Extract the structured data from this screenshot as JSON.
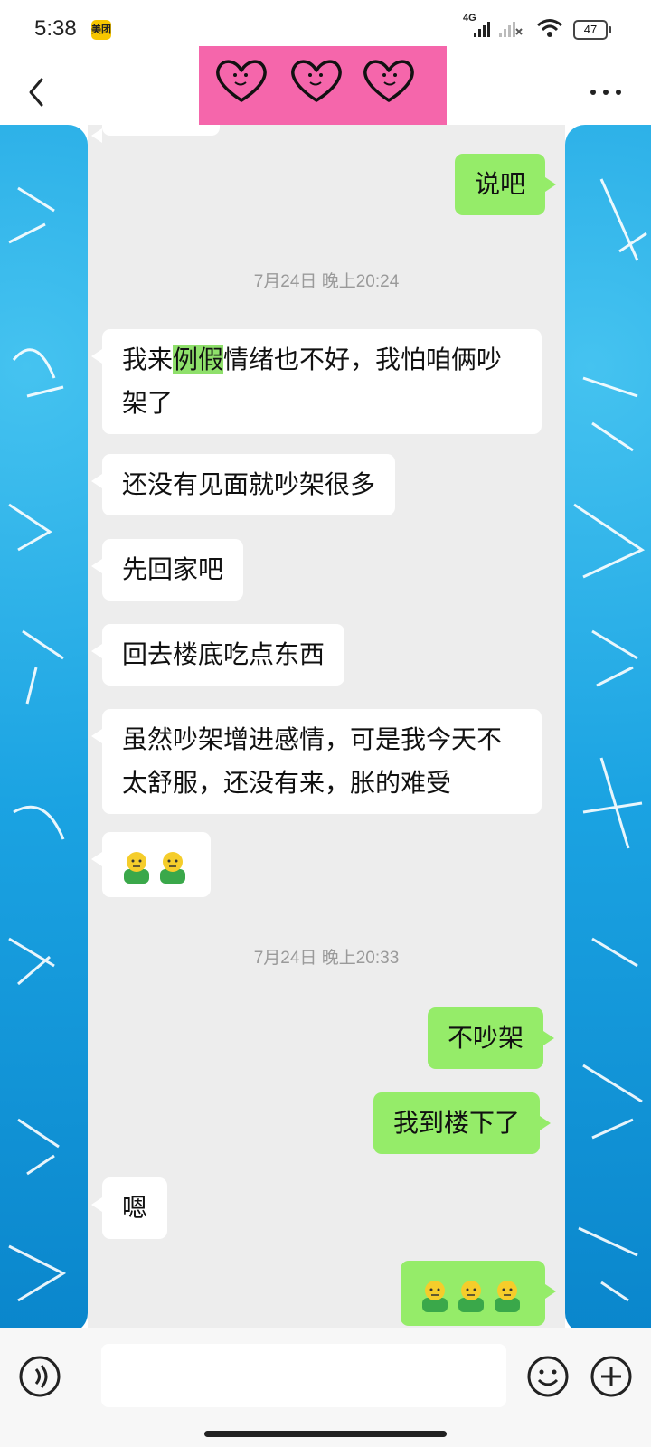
{
  "status_bar": {
    "time": "5:38",
    "app_badge": "美团",
    "network": "4G",
    "battery": "47"
  },
  "header": {
    "back_icon": "chevron-left-icon",
    "title_graphic": "three-smiling-hearts",
    "title_bg_color": "#f566ab",
    "more_icon": "ellipsis-icon"
  },
  "colors": {
    "outgoing_bubble": "#95ec69",
    "incoming_bubble": "#ffffff",
    "chat_background": "#ededed",
    "wallpaper": "#1ba3e2"
  },
  "messages": [
    {
      "side": "out",
      "text": "说吧"
    },
    {
      "type": "timestamp",
      "text": "7月24日 晚上20:24"
    },
    {
      "side": "in",
      "parts": [
        "我来",
        "例假",
        "情绪也不好，我怕咱俩吵"
      ],
      "line2": "架了"
    },
    {
      "side": "in",
      "text": "还没有见面就吵架很多"
    },
    {
      "side": "in",
      "text": "先回家吧"
    },
    {
      "side": "in",
      "text": "回去楼底吃点东西"
    },
    {
      "side": "in",
      "line1": "虽然吵架增进感情，可是我今天不",
      "line2": "太舒服，还没有来，胀的难受"
    },
    {
      "side": "in",
      "emoji": "awkward-emoji",
      "count": 2
    },
    {
      "type": "timestamp",
      "text": "7月24日 晚上20:33"
    },
    {
      "side": "out",
      "text": "不吵架"
    },
    {
      "side": "out",
      "text": "我到楼下了"
    },
    {
      "side": "in",
      "text": "嗯"
    },
    {
      "side": "out",
      "emoji": "awkward-emoji",
      "count": 3
    }
  ],
  "input_bar": {
    "voice_icon": "voice-icon",
    "emoji_icon": "emoji-icon",
    "plus_icon": "plus-icon"
  }
}
